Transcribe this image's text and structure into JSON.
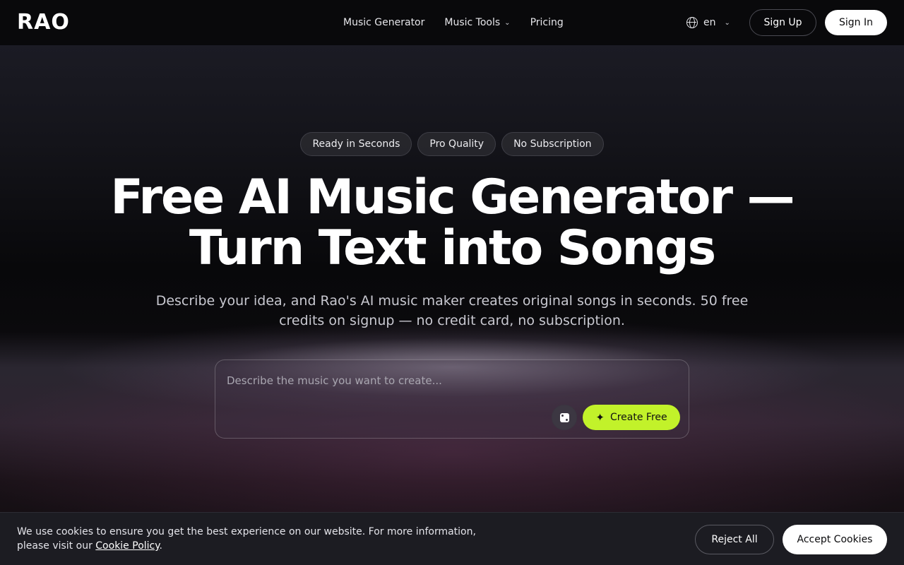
{
  "header": {
    "logo": "RAO",
    "nav": [
      {
        "label": "Music Generator"
      },
      {
        "label": "Music Tools",
        "has_dropdown": true
      },
      {
        "label": "Pricing"
      }
    ],
    "language": "en",
    "sign_up": "Sign Up",
    "sign_in": "Sign In"
  },
  "hero": {
    "pills": [
      "Ready in Seconds",
      "Pro Quality",
      "No Subscription"
    ],
    "title_line1": "Free AI Music Generator —",
    "title_line2": "Turn Text into Songs",
    "subtitle": "Describe your idea, and Rao's AI music maker creates original songs in seconds. 50 free credits on signup — no credit card, no subscription."
  },
  "prompt": {
    "placeholder": "Describe the music you want to create...",
    "value": "",
    "create_label": "Create Free",
    "accent_color": "#c2f22a"
  },
  "cookie": {
    "text": "We use cookies to ensure you get the best experience on our website. For more information, please visit our ",
    "link_label": "Cookie Policy",
    "text_end": ".",
    "reject_label": "Reject All",
    "accept_label": "Accept Cookies"
  },
  "icons": {
    "language": "globe-icon",
    "dropdown": "chevron-down-icon",
    "random": "dice-icon",
    "create": "sparkle-icon"
  }
}
